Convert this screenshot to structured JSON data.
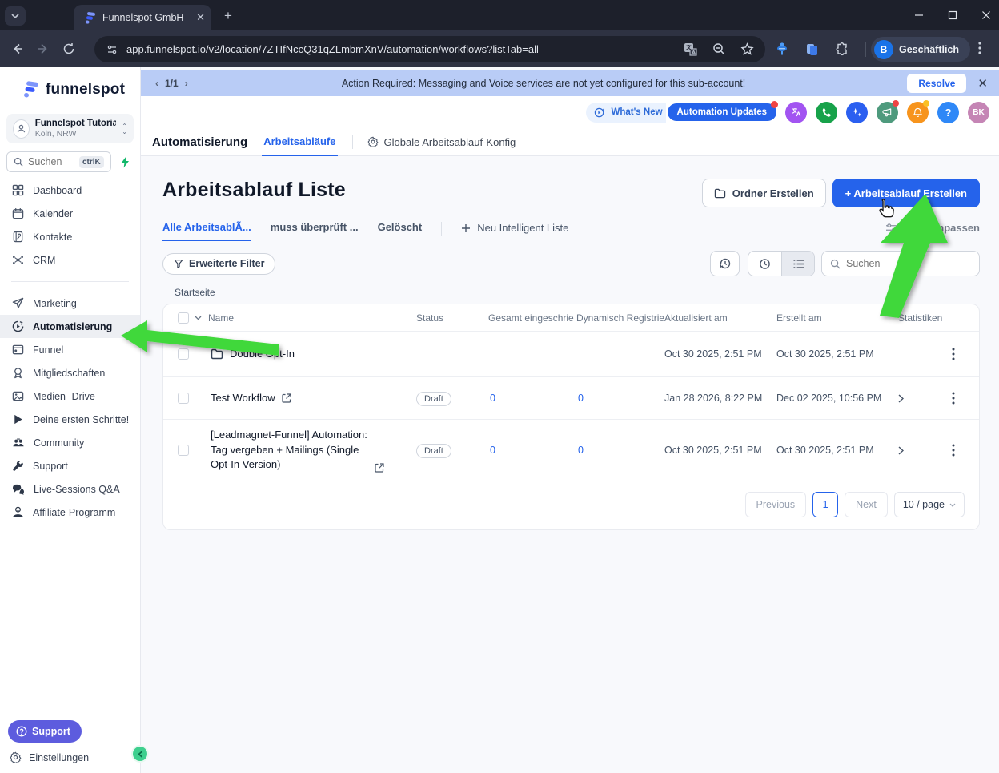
{
  "browser": {
    "tab_title": "Funnelspot GmbH",
    "url": "app.funnelspot.io/v2/location/7ZTIfNccQ31qZLmbmXnV/automation/workflows?listTab=all",
    "profile": {
      "initial": "B",
      "name": "Geschäftlich"
    }
  },
  "banner": {
    "pager": "1/1",
    "message": "Action Required: Messaging and Voice services are not yet configured for this sub-account!",
    "resolve_label": "Resolve"
  },
  "topbar": {
    "whats_new": "What's New",
    "automation_updates": "Automation Updates",
    "help_glyph": "?",
    "avatar_initials": "BK"
  },
  "nav": {
    "title": "Automatisierung",
    "workflows_tab": "Arbeitsabläufe",
    "global_config": "Globale Arbeitsablauf-Konfig"
  },
  "sidebar": {
    "brand": "funnelspot",
    "account": {
      "name": "Funnelspot Tutorial ...",
      "location": "Köln, NRW"
    },
    "search": {
      "placeholder": "Suchen",
      "shortcut": "ctrlK"
    },
    "items": [
      {
        "label": "Dashboard"
      },
      {
        "label": "Kalender"
      },
      {
        "label": "Kontakte"
      },
      {
        "label": "CRM"
      },
      {
        "label": "Marketing"
      },
      {
        "label": "Automatisierung"
      },
      {
        "label": "Funnel"
      },
      {
        "label": "Mitgliedschaften"
      },
      {
        "label": "Medien- Drive"
      },
      {
        "label": "Deine ersten Schritte!"
      },
      {
        "label": "Community"
      },
      {
        "label": "Support"
      },
      {
        "label": "Live-Sessions Q&A"
      },
      {
        "label": "Affiliate-Programm"
      }
    ],
    "support_button": "Support",
    "settings": "Einstellungen"
  },
  "main": {
    "title": "Arbeitsablauf Liste",
    "create_folder": "Ordner Erstellen",
    "create_workflow": "+ Arbeitsablauf Erstellen",
    "tabs": [
      {
        "label": "Alle ArbeitsablÃ..."
      },
      {
        "label": "muss überprüft ..."
      },
      {
        "label": "Gelöscht"
      }
    ],
    "new_smart_list": "Neu Intelligent Liste",
    "customize_list": "Liste Anpassen",
    "advanced_filter": "Erweiterte Filter",
    "search_placeholder": "Suchen",
    "breadcrumb": "Startseite",
    "table": {
      "columns": [
        "Name",
        "Status",
        "Gesamt eingeschrie",
        "Dynamisch Registrie",
        "Aktualisiert am",
        "Erstellt am",
        "Statistiken"
      ],
      "rows": [
        {
          "name": "Double Opt-In",
          "status": "",
          "enrolled": "",
          "dynamic": "",
          "updated": "Oct 30 2025, 2:51 PM",
          "created": "Oct 30 2025, 2:51 PM"
        },
        {
          "name": "Test Workflow",
          "status": "Draft",
          "enrolled": "0",
          "dynamic": "0",
          "updated": "Jan 28 2026, 8:22 PM",
          "created": "Dec 02 2025, 10:56 PM"
        },
        {
          "name": "[Leadmagnet-Funnel] Automation: Tag vergeben + Mailings (Single Opt-In Version)",
          "status": "Draft",
          "enrolled": "0",
          "dynamic": "0",
          "updated": "Oct 30 2025, 2:51 PM",
          "created": "Oct 30 2025, 2:51 PM"
        }
      ]
    },
    "pagination": {
      "previous": "Previous",
      "page": "1",
      "next": "Next",
      "size": "10 / page"
    }
  },
  "colors": {
    "accent_blue": "#2563eb",
    "banner_blue": "#b9ccf6",
    "annotation_green": "#41d83b",
    "support_indigo": "#5d5cde",
    "collapse_green": "#3ecf8e"
  }
}
